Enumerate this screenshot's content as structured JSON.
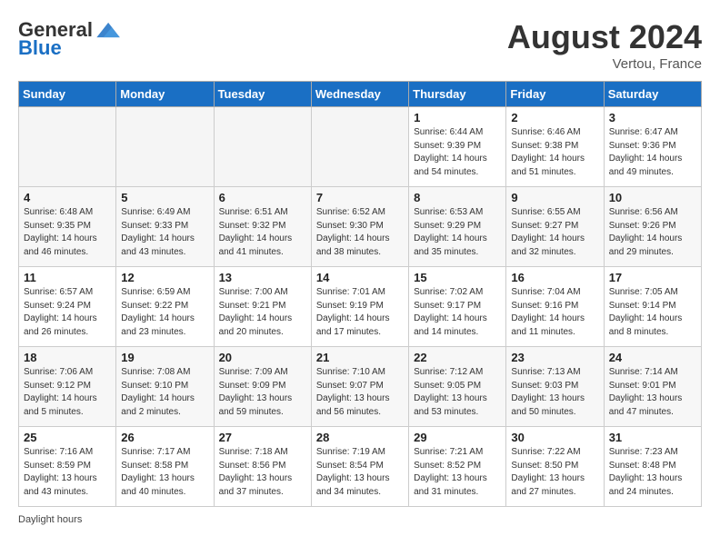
{
  "header": {
    "logo_general": "General",
    "logo_blue": "Blue",
    "month_year": "August 2024",
    "location": "Vertou, France"
  },
  "days_of_week": [
    "Sunday",
    "Monday",
    "Tuesday",
    "Wednesday",
    "Thursday",
    "Friday",
    "Saturday"
  ],
  "footer": {
    "daylight_label": "Daylight hours"
  },
  "weeks": [
    [
      {
        "day": "",
        "empty": true
      },
      {
        "day": "",
        "empty": true
      },
      {
        "day": "",
        "empty": true
      },
      {
        "day": "",
        "empty": true
      },
      {
        "day": "1",
        "sunrise": "Sunrise: 6:44 AM",
        "sunset": "Sunset: 9:39 PM",
        "daylight": "Daylight: 14 hours and 54 minutes."
      },
      {
        "day": "2",
        "sunrise": "Sunrise: 6:46 AM",
        "sunset": "Sunset: 9:38 PM",
        "daylight": "Daylight: 14 hours and 51 minutes."
      },
      {
        "day": "3",
        "sunrise": "Sunrise: 6:47 AM",
        "sunset": "Sunset: 9:36 PM",
        "daylight": "Daylight: 14 hours and 49 minutes."
      }
    ],
    [
      {
        "day": "4",
        "sunrise": "Sunrise: 6:48 AM",
        "sunset": "Sunset: 9:35 PM",
        "daylight": "Daylight: 14 hours and 46 minutes."
      },
      {
        "day": "5",
        "sunrise": "Sunrise: 6:49 AM",
        "sunset": "Sunset: 9:33 PM",
        "daylight": "Daylight: 14 hours and 43 minutes."
      },
      {
        "day": "6",
        "sunrise": "Sunrise: 6:51 AM",
        "sunset": "Sunset: 9:32 PM",
        "daylight": "Daylight: 14 hours and 41 minutes."
      },
      {
        "day": "7",
        "sunrise": "Sunrise: 6:52 AM",
        "sunset": "Sunset: 9:30 PM",
        "daylight": "Daylight: 14 hours and 38 minutes."
      },
      {
        "day": "8",
        "sunrise": "Sunrise: 6:53 AM",
        "sunset": "Sunset: 9:29 PM",
        "daylight": "Daylight: 14 hours and 35 minutes."
      },
      {
        "day": "9",
        "sunrise": "Sunrise: 6:55 AM",
        "sunset": "Sunset: 9:27 PM",
        "daylight": "Daylight: 14 hours and 32 minutes."
      },
      {
        "day": "10",
        "sunrise": "Sunrise: 6:56 AM",
        "sunset": "Sunset: 9:26 PM",
        "daylight": "Daylight: 14 hours and 29 minutes."
      }
    ],
    [
      {
        "day": "11",
        "sunrise": "Sunrise: 6:57 AM",
        "sunset": "Sunset: 9:24 PM",
        "daylight": "Daylight: 14 hours and 26 minutes."
      },
      {
        "day": "12",
        "sunrise": "Sunrise: 6:59 AM",
        "sunset": "Sunset: 9:22 PM",
        "daylight": "Daylight: 14 hours and 23 minutes."
      },
      {
        "day": "13",
        "sunrise": "Sunrise: 7:00 AM",
        "sunset": "Sunset: 9:21 PM",
        "daylight": "Daylight: 14 hours and 20 minutes."
      },
      {
        "day": "14",
        "sunrise": "Sunrise: 7:01 AM",
        "sunset": "Sunset: 9:19 PM",
        "daylight": "Daylight: 14 hours and 17 minutes."
      },
      {
        "day": "15",
        "sunrise": "Sunrise: 7:02 AM",
        "sunset": "Sunset: 9:17 PM",
        "daylight": "Daylight: 14 hours and 14 minutes."
      },
      {
        "day": "16",
        "sunrise": "Sunrise: 7:04 AM",
        "sunset": "Sunset: 9:16 PM",
        "daylight": "Daylight: 14 hours and 11 minutes."
      },
      {
        "day": "17",
        "sunrise": "Sunrise: 7:05 AM",
        "sunset": "Sunset: 9:14 PM",
        "daylight": "Daylight: 14 hours and 8 minutes."
      }
    ],
    [
      {
        "day": "18",
        "sunrise": "Sunrise: 7:06 AM",
        "sunset": "Sunset: 9:12 PM",
        "daylight": "Daylight: 14 hours and 5 minutes."
      },
      {
        "day": "19",
        "sunrise": "Sunrise: 7:08 AM",
        "sunset": "Sunset: 9:10 PM",
        "daylight": "Daylight: 14 hours and 2 minutes."
      },
      {
        "day": "20",
        "sunrise": "Sunrise: 7:09 AM",
        "sunset": "Sunset: 9:09 PM",
        "daylight": "Daylight: 13 hours and 59 minutes."
      },
      {
        "day": "21",
        "sunrise": "Sunrise: 7:10 AM",
        "sunset": "Sunset: 9:07 PM",
        "daylight": "Daylight: 13 hours and 56 minutes."
      },
      {
        "day": "22",
        "sunrise": "Sunrise: 7:12 AM",
        "sunset": "Sunset: 9:05 PM",
        "daylight": "Daylight: 13 hours and 53 minutes."
      },
      {
        "day": "23",
        "sunrise": "Sunrise: 7:13 AM",
        "sunset": "Sunset: 9:03 PM",
        "daylight": "Daylight: 13 hours and 50 minutes."
      },
      {
        "day": "24",
        "sunrise": "Sunrise: 7:14 AM",
        "sunset": "Sunset: 9:01 PM",
        "daylight": "Daylight: 13 hours and 47 minutes."
      }
    ],
    [
      {
        "day": "25",
        "sunrise": "Sunrise: 7:16 AM",
        "sunset": "Sunset: 8:59 PM",
        "daylight": "Daylight: 13 hours and 43 minutes."
      },
      {
        "day": "26",
        "sunrise": "Sunrise: 7:17 AM",
        "sunset": "Sunset: 8:58 PM",
        "daylight": "Daylight: 13 hours and 40 minutes."
      },
      {
        "day": "27",
        "sunrise": "Sunrise: 7:18 AM",
        "sunset": "Sunset: 8:56 PM",
        "daylight": "Daylight: 13 hours and 37 minutes."
      },
      {
        "day": "28",
        "sunrise": "Sunrise: 7:19 AM",
        "sunset": "Sunset: 8:54 PM",
        "daylight": "Daylight: 13 hours and 34 minutes."
      },
      {
        "day": "29",
        "sunrise": "Sunrise: 7:21 AM",
        "sunset": "Sunset: 8:52 PM",
        "daylight": "Daylight: 13 hours and 31 minutes."
      },
      {
        "day": "30",
        "sunrise": "Sunrise: 7:22 AM",
        "sunset": "Sunset: 8:50 PM",
        "daylight": "Daylight: 13 hours and 27 minutes."
      },
      {
        "day": "31",
        "sunrise": "Sunrise: 7:23 AM",
        "sunset": "Sunset: 8:48 PM",
        "daylight": "Daylight: 13 hours and 24 minutes."
      }
    ]
  ]
}
